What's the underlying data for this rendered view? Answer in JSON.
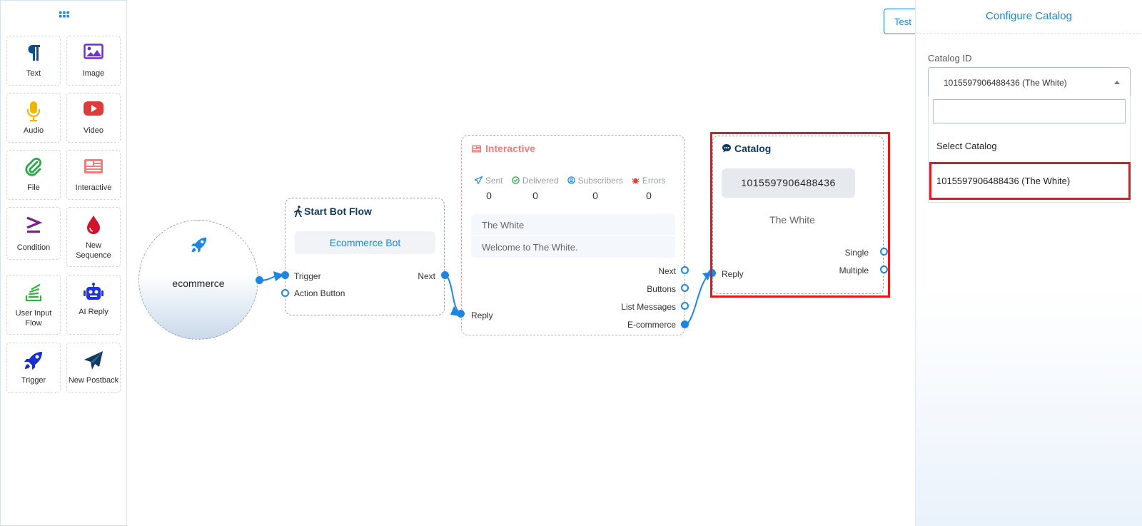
{
  "tools": [
    {
      "label": "Text",
      "icon": "pilcrow-icon",
      "color": "#0d4d8c"
    },
    {
      "label": "Image",
      "icon": "image-icon",
      "color": "#6b2fd3"
    },
    {
      "label": "Audio",
      "icon": "microphone-icon",
      "color": "#f2b500"
    },
    {
      "label": "Video",
      "icon": "youtube-icon",
      "color": "#e03a3a"
    },
    {
      "label": "File",
      "icon": "paperclip-icon",
      "color": "#29a847"
    },
    {
      "label": "Interactive",
      "icon": "newspaper-icon",
      "color": "#f07e7e"
    },
    {
      "label": "Condition",
      "icon": "greater-equal-icon",
      "color": "#7a1f8c"
    },
    {
      "label": "New Sequence",
      "icon": "droplet-icon",
      "color": "#d0142c"
    },
    {
      "label": "User Input Flow",
      "icon": "stack-icon",
      "color": "#29b83a"
    },
    {
      "label": "AI Reply",
      "icon": "robot-icon",
      "color": "#1f34e0"
    },
    {
      "label": "Trigger",
      "icon": "rocket-icon",
      "color": "#1a2ed6"
    },
    {
      "label": "New Postback",
      "icon": "paper-plane-icon",
      "color": "#12395e"
    }
  ],
  "toolbar": {
    "test_label": "Test"
  },
  "flow": {
    "trigger_node": {
      "label": "ecommerce"
    },
    "start_node": {
      "title": "Start Bot Flow",
      "bot_name": "Ecommerce Bot",
      "ports": {
        "trigger": "Trigger",
        "action": "Action Button",
        "next": "Next"
      }
    },
    "interactive_node": {
      "title": "Interactive",
      "stats": [
        {
          "label": "Sent",
          "value": "0"
        },
        {
          "label": "Delivered",
          "value": "0"
        },
        {
          "label": "Subscribers",
          "value": "0"
        },
        {
          "label": "Errors",
          "value": "0"
        }
      ],
      "header_text": "The White",
      "body_text": "Welcome to The White.",
      "reply_label": "Reply",
      "outputs": [
        "Next",
        "Buttons",
        "List Messages",
        "E-commerce"
      ]
    },
    "catalog_node": {
      "title": "Catalog",
      "catalog_id": "1015597906488436",
      "catalog_name": "The White",
      "reply_label": "Reply",
      "outputs": [
        "Single",
        "Multiple"
      ]
    }
  },
  "config_panel": {
    "title": "Configure Catalog",
    "field_label": "Catalog ID",
    "selected_value": "1015597906488436 (The White)",
    "search_value": "",
    "options": [
      "Select Catalog",
      "1015597906488436 (The White)"
    ]
  },
  "colors": {
    "accent": "#1c86e5",
    "highlight": "#e8151b",
    "interactive": "#f07e7e"
  }
}
